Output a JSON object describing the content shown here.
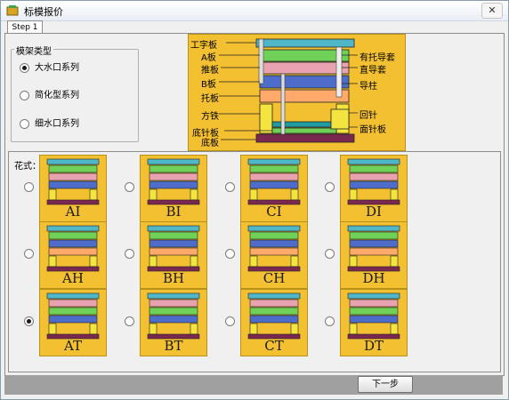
{
  "window": {
    "title": "标模报价",
    "close_label": "✕"
  },
  "tab": {
    "label": "Step 1"
  },
  "mold_type": {
    "title": "模架类型",
    "options": [
      {
        "label": "大水口系列",
        "checked": true
      },
      {
        "label": "简化型系列",
        "checked": false
      },
      {
        "label": "细水口系列",
        "checked": false
      }
    ]
  },
  "legend": {
    "left_labels": [
      "工字板",
      "A板",
      "推板",
      "B板",
      "托板",
      "方铁",
      "底针板",
      "底板"
    ],
    "right_labels": [
      "有托导套",
      "直导套",
      "导柱",
      "回针",
      "面针板"
    ]
  },
  "styles": {
    "title": "花式：",
    "items": [
      {
        "label": "AI",
        "checked": false
      },
      {
        "label": "BI",
        "checked": false
      },
      {
        "label": "CI",
        "checked": false
      },
      {
        "label": "DI",
        "checked": false
      },
      {
        "label": "AH",
        "checked": false
      },
      {
        "label": "BH",
        "checked": false
      },
      {
        "label": "CH",
        "checked": false
      },
      {
        "label": "DH",
        "checked": false
      },
      {
        "label": "AT",
        "checked": true
      },
      {
        "label": "BT",
        "checked": false
      },
      {
        "label": "CT",
        "checked": false
      },
      {
        "label": "DT",
        "checked": false
      }
    ]
  },
  "footer": {
    "next_label": "下一步"
  }
}
